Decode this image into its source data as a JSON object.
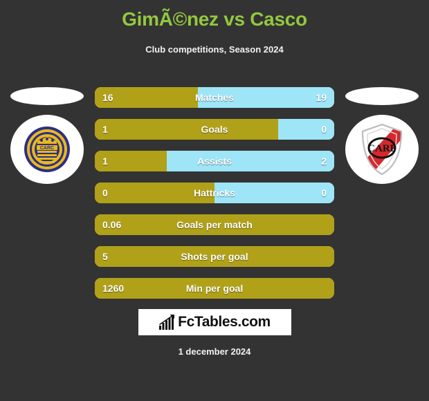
{
  "header": {
    "title": "GimÃ©nez vs Casco",
    "subtitle": "Club competitions, Season 2024"
  },
  "colors": {
    "background": "#333333",
    "title": "#93c83e",
    "home_bar": "#b0a119",
    "away_bar": "#9ee5f7",
    "text": "#ffffff",
    "logo_background": "#ffffff"
  },
  "crests": {
    "home": {
      "name": "rosario-central-crest",
      "monogram": "CARC",
      "primary": "#2a2f86",
      "secondary": "#e9b81d"
    },
    "away": {
      "name": "river-plate-crest",
      "monogram": "CARP",
      "primary": "#ffffff",
      "secondary": "#d8272c"
    }
  },
  "stats": [
    {
      "label": "Matches",
      "home": "16",
      "away": "19",
      "home_pct": 43,
      "split": true
    },
    {
      "label": "Goals",
      "home": "1",
      "away": "0",
      "home_pct": 76.5,
      "split": true
    },
    {
      "label": "Assists",
      "home": "1",
      "away": "2",
      "home_pct": 30,
      "split": true
    },
    {
      "label": "Hattricks",
      "home": "0",
      "away": "0",
      "home_pct": 50,
      "split": true
    },
    {
      "label": "Goals per match",
      "home": "0.06",
      "away": "",
      "home_pct": 100,
      "split": false
    },
    {
      "label": "Shots per goal",
      "home": "5",
      "away": "",
      "home_pct": 100,
      "split": false
    },
    {
      "label": "Min per goal",
      "home": "1260",
      "away": "",
      "home_pct": 100,
      "split": false
    }
  ],
  "logo": {
    "text": "FcTables.com",
    "icon": "bar-chart-trend-icon"
  },
  "footer": {
    "date": "1 december 2024"
  }
}
